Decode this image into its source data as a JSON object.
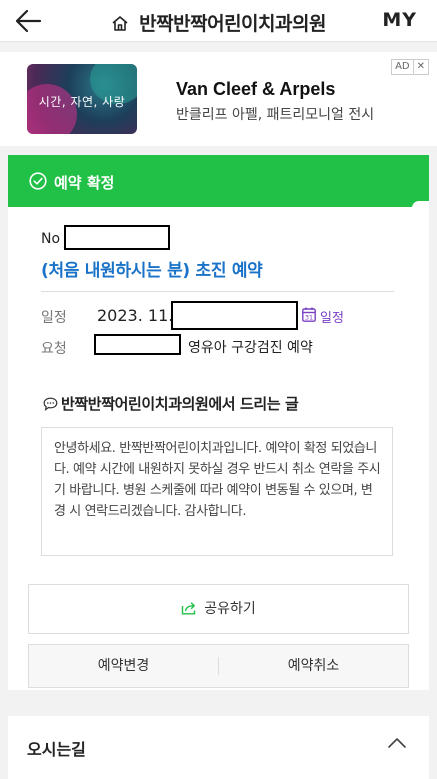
{
  "header": {
    "title": "반짝반짝어린이치과의원",
    "my_label": "MY"
  },
  "ad": {
    "image_text": "시간, 자연, 사랑",
    "brand": "Van Cleef & Arpels",
    "subtitle": "반클리프 아펠, 패트리모니얼 전시",
    "badge_ad": "AD",
    "badge_close": "✕"
  },
  "booking": {
    "status": "예약 확정",
    "no_label": "No",
    "title": "(처음 내원하시는 분) 초진 예약",
    "schedule_label": "일정",
    "date_value": "2023. 11.",
    "calendar_link": "일정",
    "request_label": "요청",
    "request_value": "영유아 구강검진 예약"
  },
  "message": {
    "heading": "반짝반짝어린이치과의원에서 드리는 글",
    "body": "안녕하세요. 반짝반짝어린이치과입니다. 예약이 확정 되었습니다. 예약 시간에 내원하지 못하실 경우 반드시 취소 연락을 주시기 바랍니다. 병원 스케줄에 따라 예약이 변동될 수 있으며, 변경 시 연락드리겠습니다. 감사합니다."
  },
  "actions": {
    "share": "공유하기",
    "change": "예약변경",
    "cancel": "예약취소"
  },
  "directions": {
    "label": "오시는길"
  },
  "colors": {
    "status_green": "#21c046",
    "title_blue": "#1a73c8",
    "calendar_purple": "#7b3fc4",
    "share_icon_green": "#21c046"
  }
}
